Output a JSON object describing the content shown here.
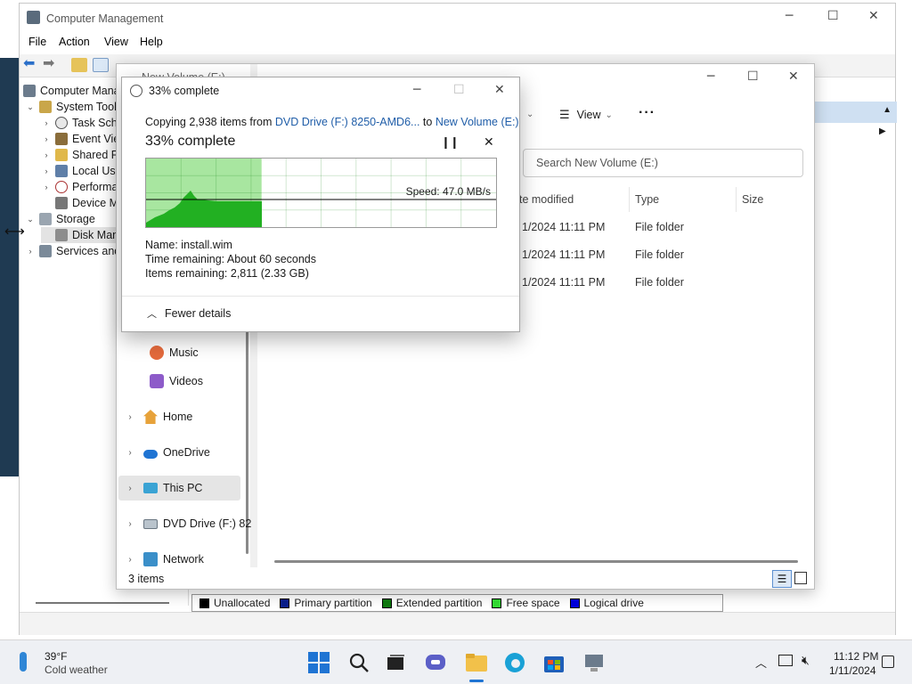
{
  "computer_management": {
    "title": "Computer Management",
    "menu": [
      "File",
      "Action",
      "View",
      "Help"
    ],
    "tree": [
      {
        "label": "Computer Mana",
        "level": 0,
        "arrow": ""
      },
      {
        "label": "System Tool",
        "level": 1,
        "arrow": "v"
      },
      {
        "label": "Task Sch",
        "level": 2,
        "arrow": ">"
      },
      {
        "label": "Event Vie",
        "level": 2,
        "arrow": ">"
      },
      {
        "label": "Shared F",
        "level": 2,
        "arrow": ">"
      },
      {
        "label": "Local Us",
        "level": 2,
        "arrow": ">"
      },
      {
        "label": "Performa",
        "level": 2,
        "arrow": ">"
      },
      {
        "label": "Device M",
        "level": 2,
        "arrow": ""
      },
      {
        "label": "Storage",
        "level": 1,
        "arrow": "v"
      },
      {
        "label": "Disk Man",
        "level": 2,
        "arrow": ""
      },
      {
        "label": "Services and",
        "level": 1,
        "arrow": ">"
      }
    ],
    "legend": [
      {
        "label": "Unallocated",
        "color": "#000000"
      },
      {
        "label": "Primary partition",
        "color": "#0a1f8c"
      },
      {
        "label": "Extended partition",
        "color": "#0f7a0f"
      },
      {
        "label": "Free space",
        "color": "#33dd33"
      },
      {
        "label": "Logical drive",
        "color": "#0000dd"
      }
    ]
  },
  "explorer": {
    "title": "New Volume (E:)",
    "view_label": "View",
    "more_label": "···",
    "search_placeholder": "Search New Volume (E:)",
    "columns": {
      "date": "te modified",
      "type": "Type",
      "size": "Size"
    },
    "rows": [
      {
        "date": "1/2024 11:11 PM",
        "type": "File folder"
      },
      {
        "date": "1/2024 11:11 PM",
        "type": "File folder"
      },
      {
        "date": "1/2024 11:11 PM",
        "type": "File folder"
      }
    ],
    "nav": {
      "music": "Music",
      "videos": "Videos",
      "home": "Home",
      "onedrive": "OneDrive",
      "thispc": "This PC",
      "dvd": "DVD Drive (F:) 82",
      "network": "Network"
    },
    "status": "3 items"
  },
  "copy_dialog": {
    "title": "33% complete",
    "copying_prefix": "Copying 2,938 items from ",
    "source": "DVD Drive (F:) 8250-AMD6...",
    "to_word": " to ",
    "destination": "New Volume (E:)",
    "percent_text": "33% complete",
    "progress": 0.33,
    "speed": "Speed: 47.0 MB/s",
    "name_line": "Name:  install.wim",
    "time_line": "Time remaining:  About 60 seconds",
    "items_line": "Items remaining:  2,811 (2.33 GB)",
    "fewer_details": "Fewer details"
  },
  "taskbar": {
    "weather_temp": "39°F",
    "weather_desc": "Cold weather",
    "time": "11:12 PM",
    "date": "1/11/2024"
  }
}
